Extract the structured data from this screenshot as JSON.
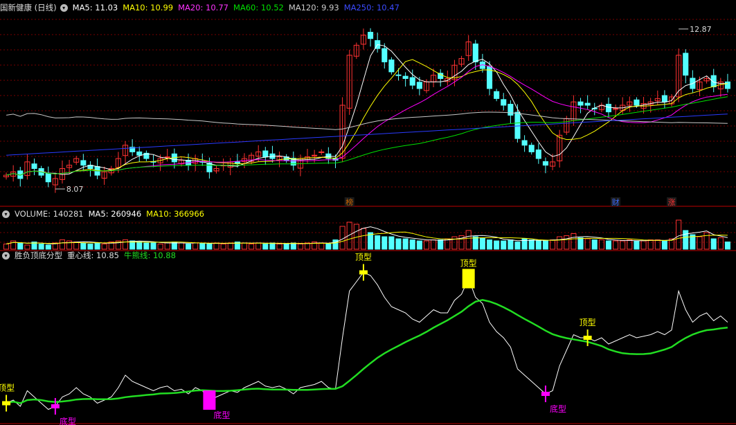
{
  "colors": {
    "up": "#ff3232",
    "down": "#54ffff",
    "ma5": "#ffffff",
    "ma10": "#ffff00",
    "ma20": "#ff00ff",
    "ma60": "#00e000",
    "ma120": "#c8c8c8",
    "ma250": "#2a3bff",
    "grid": "#7a0000",
    "separator": "#c00000",
    "center": "#22dd22",
    "top_sig": "#ffff00",
    "bottom_sig": "#ff00ff"
  },
  "price_panel": {
    "stock": "国新健康 (日线)",
    "ma5": "MA5: 11.03",
    "ma10": "MA10: 10.99",
    "ma20": "MA20: 10.77",
    "ma60": "MA60: 10.52",
    "ma120": "MA120: 9.93",
    "ma250": "MA250: 10.47",
    "high_label": "12.87",
    "low_label": "8.07",
    "event_labels": [
      {
        "text": "榜"
      },
      {
        "text": "财"
      },
      {
        "text": "涨"
      }
    ]
  },
  "volume_panel": {
    "title": "VOLUME: 140281",
    "ma5": "MA5: 260946",
    "ma10": "MA10: 366966"
  },
  "indicator_panel": {
    "name": "胜负顶底分型",
    "center_line": "重心线: 10.85",
    "bull_line": "牛熊线: 10.88",
    "top_label": "顶型",
    "bottom_label": "底型"
  },
  "icons": {
    "panel_menu": "chevron-down-icon"
  },
  "chart_data": {
    "type": "candlestick",
    "price_extremes": {
      "high": 12.87,
      "low": 8.07
    },
    "closes": [
      8.4,
      8.5,
      8.3,
      8.8,
      8.6,
      8.4,
      8.2,
      8.3,
      8.6,
      8.7,
      8.9,
      8.7,
      8.6,
      8.4,
      8.5,
      8.6,
      8.9,
      9.3,
      9.1,
      9.0,
      8.9,
      8.8,
      8.9,
      8.95,
      8.8,
      8.85,
      8.7,
      8.9,
      8.8,
      8.5,
      8.6,
      8.7,
      8.8,
      8.75,
      8.9,
      9.0,
      9.1,
      8.95,
      8.9,
      8.95,
      8.85,
      8.7,
      8.9,
      8.95,
      9.0,
      9.1,
      8.9,
      8.85,
      10.5,
      12.0,
      12.3,
      12.6,
      12.5,
      12.2,
      11.8,
      11.5,
      11.4,
      11.3,
      11.1,
      11.0,
      11.2,
      11.4,
      11.3,
      11.3,
      11.7,
      11.9,
      12.4,
      11.8,
      11.6,
      11.0,
      10.7,
      10.5,
      10.2,
      9.5,
      9.3,
      9.1,
      8.9,
      8.7,
      8.8,
      9.6,
      10.1,
      10.6,
      10.5,
      10.5,
      10.4,
      10.5,
      10.3,
      10.4,
      10.5,
      10.6,
      10.5,
      10.55,
      10.6,
      10.7,
      10.6,
      10.75,
      12.0,
      11.4,
      11.0,
      11.2,
      11.3,
      11.05,
      11.2,
      11.0
    ],
    "volumes": [
      5,
      8,
      6,
      4,
      7,
      5,
      4,
      6,
      9,
      8,
      7,
      6,
      5,
      6,
      5,
      7,
      8,
      9,
      8,
      7,
      6,
      6,
      5,
      6,
      7,
      6,
      5,
      6,
      6,
      5,
      6,
      5,
      6,
      7,
      6,
      5,
      6,
      5,
      6,
      5,
      5,
      6,
      5,
      6,
      7,
      6,
      5,
      9,
      22,
      26,
      24,
      20,
      16,
      13,
      12,
      12,
      10,
      10,
      9,
      8,
      8,
      9,
      9,
      10,
      12,
      13,
      18,
      12,
      11,
      9,
      8,
      8,
      9,
      7,
      10,
      9,
      8,
      8,
      9,
      12,
      13,
      15,
      11,
      10,
      9,
      9,
      8,
      8,
      8,
      9,
      8,
      8,
      9,
      9,
      8,
      10,
      28,
      18,
      14,
      12,
      16,
      10,
      11,
      7
    ],
    "indicator_line": [
      8.4,
      8.5,
      8.3,
      8.8,
      8.6,
      8.4,
      8.2,
      8.3,
      8.6,
      8.7,
      8.9,
      8.7,
      8.6,
      8.4,
      8.5,
      8.6,
      8.9,
      9.3,
      9.1,
      9.0,
      8.9,
      8.8,
      8.9,
      8.95,
      8.8,
      8.85,
      8.7,
      8.9,
      8.8,
      8.5,
      8.6,
      8.7,
      8.8,
      8.75,
      8.9,
      9.0,
      9.1,
      8.95,
      8.9,
      8.95,
      8.85,
      8.7,
      8.9,
      8.95,
      9.0,
      9.1,
      8.9,
      8.85,
      10.5,
      12.0,
      12.3,
      12.6,
      12.5,
      12.2,
      11.8,
      11.5,
      11.4,
      11.3,
      11.1,
      11.0,
      11.2,
      11.4,
      11.3,
      11.3,
      11.7,
      11.9,
      12.4,
      11.8,
      11.6,
      11.0,
      10.7,
      10.5,
      10.2,
      9.5,
      9.3,
      9.1,
      8.9,
      8.7,
      8.8,
      9.6,
      10.1,
      10.6,
      10.5,
      10.5,
      10.4,
      10.5,
      10.3,
      10.4,
      10.5,
      10.6,
      10.5,
      10.55,
      10.6,
      10.7,
      10.6,
      10.75,
      12.0,
      11.4,
      11.0,
      11.2,
      11.3,
      11.05,
      11.2,
      11.0
    ],
    "center_line_end": 10.85,
    "top_signals": [
      0,
      51,
      66,
      83
    ],
    "bottom_signals": [
      7,
      29,
      77
    ]
  }
}
